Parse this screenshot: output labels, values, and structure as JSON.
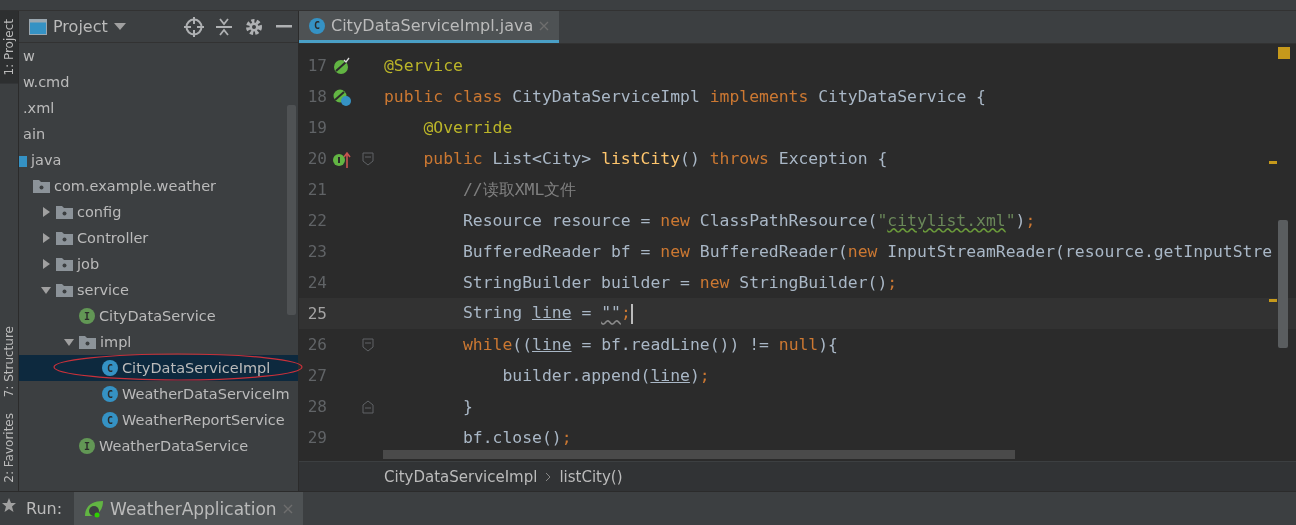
{
  "tool_strip": [
    {
      "label": "1: Project",
      "selected": true
    },
    {
      "label": "7: Structure",
      "selected": false
    },
    {
      "label": "2: Favorites",
      "selected": false
    }
  ],
  "project_panel": {
    "title": "Project",
    "tree": [
      {
        "label": "w",
        "selected": false
      },
      {
        "label": "w.cmd",
        "selected": false
      },
      {
        "label": ".xml",
        "selected": false
      },
      {
        "label": "ain",
        "selected": false,
        "children": [
          {
            "label": "java",
            "kind": "source",
            "selected": false,
            "children": [
              {
                "label": "com.example.weather",
                "kind": "package",
                "selected": false,
                "children": [
                  {
                    "label": "config",
                    "kind": "package",
                    "expanded": false,
                    "selected": false
                  },
                  {
                    "label": "Controller",
                    "kind": "package",
                    "expanded": false,
                    "selected": false
                  },
                  {
                    "label": "job",
                    "kind": "package",
                    "expanded": false,
                    "selected": false
                  },
                  {
                    "label": "service",
                    "kind": "package",
                    "expanded": true,
                    "selected": false,
                    "children": [
                      {
                        "label": "CityDataService",
                        "kind": "interface",
                        "badge": "I",
                        "selected": false
                      },
                      {
                        "label": "impl",
                        "kind": "package",
                        "expanded": true,
                        "selected": false,
                        "children": [
                          {
                            "label": "CityDataServiceImpl",
                            "kind": "class",
                            "badge": "C",
                            "selected": true
                          },
                          {
                            "label": "WeatherDataServiceIm",
                            "kind": "class",
                            "badge": "C",
                            "selected": false
                          },
                          {
                            "label": "WeatherReportService",
                            "kind": "class",
                            "badge": "C",
                            "selected": false
                          }
                        ]
                      },
                      {
                        "label": "WeatherDataService",
                        "kind": "interface",
                        "badge": "I",
                        "selected": false
                      }
                    ]
                  }
                ]
              }
            ]
          }
        ]
      }
    ]
  },
  "editor": {
    "tabs": [
      {
        "label": "CityDataServiceImpl.java",
        "badge": "C",
        "selected": true
      }
    ],
    "lines": [
      {
        "number": "17",
        "selected": false,
        "caret": false,
        "gutter": {
          "kind": "bean"
        },
        "tokens": [
          {
            "text": "@Service",
            "kind": "ann"
          }
        ]
      },
      {
        "number": "18",
        "selected": false,
        "caret": false,
        "gutter": {
          "kind": "bean-class"
        },
        "tokens": [
          {
            "text": "public class ",
            "kind": "kw"
          },
          {
            "text": "CityDataServiceImpl ",
            "kind": "plain"
          },
          {
            "text": "implements ",
            "kind": "kw"
          },
          {
            "text": "CityDataService {",
            "kind": "plain"
          }
        ]
      },
      {
        "number": "19",
        "selected": false,
        "caret": false,
        "tokens": [
          {
            "text": "    @Override",
            "kind": "ann"
          }
        ]
      },
      {
        "number": "20",
        "selected": false,
        "caret": false,
        "gutter": {
          "kind": "implements"
        },
        "fold": {
          "kind": "start"
        },
        "tokens": [
          {
            "text": "    public ",
            "kind": "kw"
          },
          {
            "text": "List<City> ",
            "kind": "plain"
          },
          {
            "text": "listCity",
            "kind": "fn"
          },
          {
            "text": "() ",
            "kind": "plain"
          },
          {
            "text": "throws ",
            "kind": "kw"
          },
          {
            "text": "Exception {",
            "kind": "plain"
          }
        ]
      },
      {
        "number": "21",
        "selected": false,
        "caret": false,
        "tokens": [
          {
            "text": "        //读取XML文件",
            "kind": "comment"
          }
        ]
      },
      {
        "number": "22",
        "selected": false,
        "caret": false,
        "tokens": [
          {
            "text": "        Resource resource = ",
            "kind": "plain"
          },
          {
            "text": "new ",
            "kind": "kw"
          },
          {
            "text": "ClassPathResource(",
            "kind": "plain"
          },
          {
            "text": "\"",
            "kind": "str"
          },
          {
            "text": "citylist.xml",
            "kind": "str-warn"
          },
          {
            "text": "\"",
            "kind": "str"
          },
          {
            "text": ")",
            "kind": "plain"
          },
          {
            "text": ";",
            "kind": "kw"
          }
        ]
      },
      {
        "number": "23",
        "selected": false,
        "caret": false,
        "tokens": [
          {
            "text": "        BufferedReader bf = ",
            "kind": "plain"
          },
          {
            "text": "new ",
            "kind": "kw"
          },
          {
            "text": "BufferedReader(",
            "kind": "plain"
          },
          {
            "text": "new ",
            "kind": "kw"
          },
          {
            "text": "InputStreamReader(resource.getInputStre",
            "kind": "plain"
          }
        ]
      },
      {
        "number": "24",
        "selected": false,
        "caret": false,
        "tokens": [
          {
            "text": "        StringBuilder builder = ",
            "kind": "plain"
          },
          {
            "text": "new ",
            "kind": "kw"
          },
          {
            "text": "StringBuilder()",
            "kind": "plain"
          },
          {
            "text": ";",
            "kind": "kw"
          }
        ]
      },
      {
        "number": "25",
        "selected": true,
        "caret": true,
        "tokens": [
          {
            "text": "        String ",
            "kind": "plain"
          },
          {
            "text": "line",
            "kind": "var"
          },
          {
            "text": " = ",
            "kind": "plain"
          },
          {
            "text": "\"\"",
            "kind": "warn"
          },
          {
            "text": ";",
            "kind": "kw"
          }
        ]
      },
      {
        "number": "26",
        "selected": false,
        "caret": false,
        "fold": {
          "kind": "start"
        },
        "tokens": [
          {
            "text": "        while",
            "kind": "kw"
          },
          {
            "text": "((",
            "kind": "plain"
          },
          {
            "text": "line",
            "kind": "var"
          },
          {
            "text": " = bf.readLine()) != ",
            "kind": "plain"
          },
          {
            "text": "null",
            "kind": "kw"
          },
          {
            "text": "){",
            "kind": "plain"
          }
        ]
      },
      {
        "number": "27",
        "selected": false,
        "caret": false,
        "tokens": [
          {
            "text": "            builder.append(",
            "kind": "plain"
          },
          {
            "text": "line",
            "kind": "var"
          },
          {
            "text": ")",
            "kind": "plain"
          },
          {
            "text": ";",
            "kind": "kw"
          }
        ]
      },
      {
        "number": "28",
        "selected": false,
        "caret": false,
        "fold": {
          "kind": "end"
        },
        "tokens": [
          {
            "text": "        }",
            "kind": "plain"
          }
        ]
      },
      {
        "number": "29",
        "selected": false,
        "caret": false,
        "tokens": [
          {
            "text": "        bf.close()",
            "kind": "plain"
          },
          {
            "text": ";",
            "kind": "kw"
          }
        ]
      }
    ],
    "breadcrumbs": [
      "CityDataServiceImpl",
      "listCity()"
    ]
  },
  "run_bar": {
    "label": "Run:",
    "tabs": [
      {
        "label": "WeatherApplication",
        "selected": true
      }
    ]
  }
}
